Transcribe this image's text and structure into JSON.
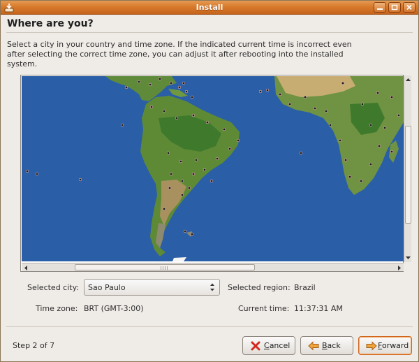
{
  "window": {
    "title": "Install"
  },
  "page": {
    "heading": "Where are you?",
    "description": "Select a city in your country and time zone. If the indicated current time is incorrect even after selecting the correct time zone, you can adjust it after rebooting into the installed system."
  },
  "fields": {
    "selected_city_label": "Selected city:",
    "selected_city_value": "Sao Paulo",
    "selected_region_label": "Selected region:",
    "selected_region_value": "Brazil",
    "time_zone_label": "Time zone:",
    "time_zone_value": "BRT (GMT-3:00)",
    "current_time_label": "Current time:",
    "current_time_value": "11:37:31 AM"
  },
  "footer": {
    "step": "Step 2 of 7",
    "cancel": {
      "mnemonic": "C",
      "rest": "ancel"
    },
    "back": {
      "mnemonic": "B",
      "rest": "ack"
    },
    "forward": {
      "mnemonic": "F",
      "rest": "orward"
    }
  },
  "icons": {
    "app": "installer-icon",
    "cancel": "cancel-icon",
    "back": "arrow-left-icon",
    "forward": "arrow-right-icon"
  },
  "colors": {
    "titlebar": "#d87a2c",
    "ocean": "#2a5ea6",
    "land": "#5f8a3a",
    "focus": "#d0661e"
  }
}
